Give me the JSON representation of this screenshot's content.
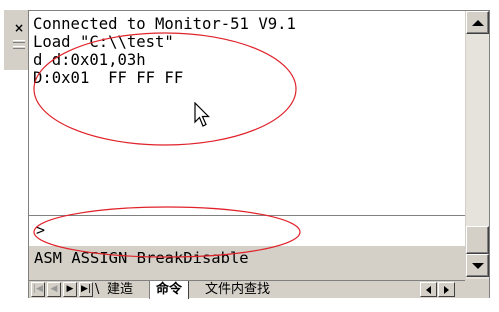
{
  "output": {
    "lines": [
      "Connected to Monitor-51 V9.1",
      "Load \"C:\\\\test\"",
      "d d:0x01,03h",
      "D:0x01  FF FF FF"
    ]
  },
  "command": {
    "prompt": ">",
    "value": ""
  },
  "hint": {
    "text": "ASM ASSIGN BreakDisable"
  },
  "dock": {
    "close_glyph": "×"
  },
  "tabs": [
    {
      "label": "建造",
      "active": false
    },
    {
      "label": "命令",
      "active": true
    },
    {
      "label": "文件内查找",
      "active": false
    }
  ],
  "nav": {
    "first": "|◀",
    "prev": "◀",
    "next": "▶",
    "last": "▶|"
  },
  "icons": {
    "scroll_up": "triangle-up",
    "scroll_down": "triangle-down",
    "scroll_left": "triangle-left",
    "scroll_right": "triangle-right",
    "cursor": "mouse-pointer"
  },
  "colors": {
    "annotation": "#e0222a",
    "chrome": "#d4d0c8",
    "text": "#000000"
  }
}
